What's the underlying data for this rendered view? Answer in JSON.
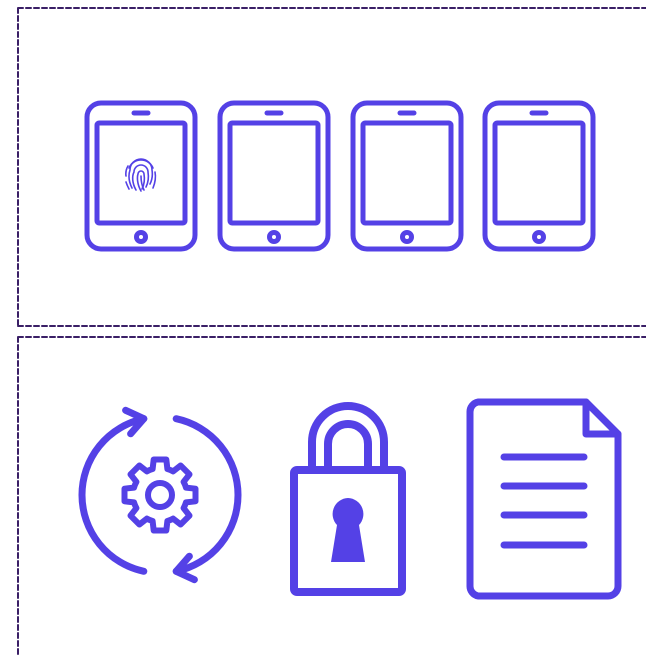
{
  "theme": {
    "icon_color": "#5441e6",
    "border_color": "#3a1f66",
    "background": "#ffffff"
  },
  "top_panel": {
    "tablets": [
      {
        "icon": "tablet-fingerprint-icon",
        "has_fingerprint": true
      },
      {
        "icon": "tablet-icon",
        "has_fingerprint": false
      },
      {
        "icon": "tablet-icon",
        "has_fingerprint": false
      },
      {
        "icon": "tablet-icon",
        "has_fingerprint": false
      }
    ]
  },
  "bottom_panel": {
    "icons": [
      "sync-gear-icon",
      "padlock-icon",
      "document-icon"
    ]
  }
}
